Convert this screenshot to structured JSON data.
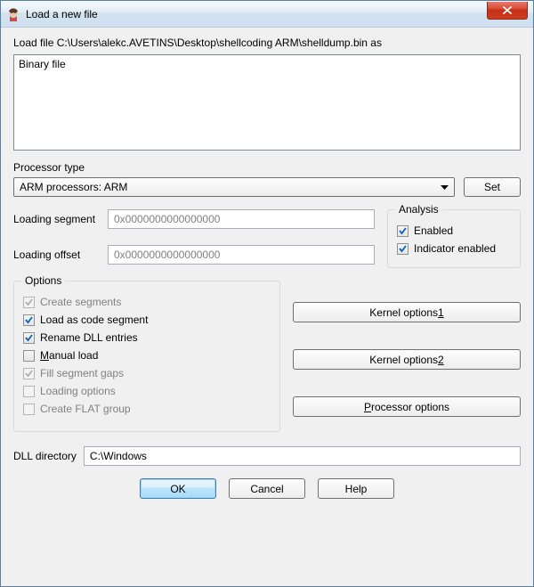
{
  "window": {
    "title": "Load a new file"
  },
  "load_file_prefix": "Load file ",
  "load_file_path": "C:\\Users\\alekc.AVETINS\\Desktop\\shellcoding ARM\\shelldump.bin",
  "load_file_suffix": " as",
  "file_list": {
    "items": [
      "Binary file"
    ]
  },
  "processor": {
    "label": "Processor type",
    "selected": "ARM processors: ARM",
    "set_button": "Set"
  },
  "loading_segment": {
    "label": "Loading segment",
    "value": "0x0000000000000000"
  },
  "loading_offset": {
    "label": "Loading offset",
    "value": "0x0000000000000000"
  },
  "analysis": {
    "title": "Analysis",
    "enabled": {
      "label": "Enabled",
      "checked": true
    },
    "indicator": {
      "label": "Indicator enabled",
      "checked": true
    }
  },
  "options": {
    "title": "Options",
    "create_segments": {
      "label": "Create segments",
      "checked": true,
      "enabled": false
    },
    "load_as_code": {
      "label": "Load as code segment",
      "checked": true,
      "enabled": true
    },
    "rename_dll": {
      "label": "Rename DLL entries",
      "checked": true,
      "enabled": true
    },
    "manual_load": {
      "label": "Manual load",
      "label_pre": "",
      "label_u": "M",
      "label_post": "anual load",
      "checked": false,
      "enabled": true
    },
    "fill_gaps": {
      "label": "Fill segment gaps",
      "checked": true,
      "enabled": false
    },
    "loading_options": {
      "label": "Loading options",
      "checked": false,
      "enabled": false
    },
    "create_flat": {
      "label": "Create FLAT group",
      "checked": false,
      "enabled": false
    }
  },
  "kernel": {
    "opt1_pre": "Kernel options ",
    "opt1_u": "1",
    "opt2_pre": "Kernel options ",
    "opt2_u": "2",
    "proc_pre": "",
    "proc_u": "P",
    "proc_post": "rocessor options"
  },
  "dll": {
    "label": "DLL directory",
    "value": "C:\\Windows"
  },
  "buttons": {
    "ok": "OK",
    "cancel": "Cancel",
    "help": "Help"
  }
}
